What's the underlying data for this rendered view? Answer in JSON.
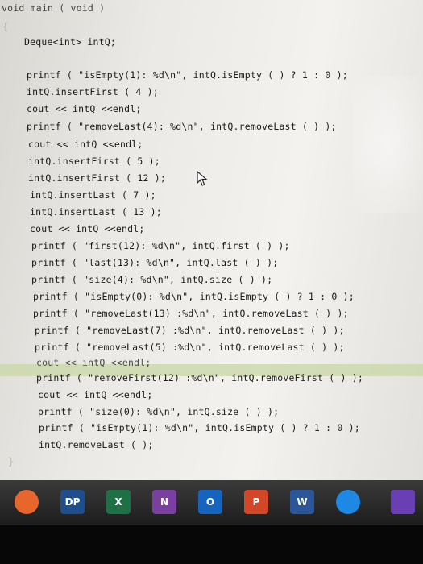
{
  "code": {
    "header": "void main ( void )",
    "open_brace": "{",
    "close_brace": "}",
    "declaration": "Deque<int> intQ;",
    "lines": [
      "printf ( \"isEmpty(1): %d\\n\", intQ.isEmpty ( ) ? 1 : 0 );",
      "intQ.insertFirst ( 4 );",
      "cout << intQ <<endl;",
      "printf ( \"removeLast(4): %d\\n\", intQ.removeLast ( ) );",
      "cout << intQ <<endl;",
      "intQ.insertFirst ( 5 );",
      "intQ.insertFirst ( 12 );",
      "intQ.insertLast ( 7 );",
      "intQ.insertLast ( 13 );",
      "cout << intQ <<endl;",
      "printf ( \"first(12): %d\\n\", intQ.first ( ) );",
      "printf ( \"last(13): %d\\n\", intQ.last ( ) );",
      "printf ( \"size(4): %d\\n\", intQ.size ( ) );",
      "printf ( \"isEmpty(0): %d\\n\", intQ.isEmpty ( ) ? 1 : 0 );",
      "printf ( \"removeLast(13) :%d\\n\", intQ.removeLast ( ) );",
      "printf ( \"removeLast(7) :%d\\n\", intQ.removeLast ( ) );",
      "printf ( \"removeLast(5) :%d\\n\", intQ.removeLast ( ) );",
      "cout << intQ <<endl;",
      "printf ( \"removeFirst(12) :%d\\n\", intQ.removeFirst ( ) );",
      "cout << intQ <<endl;",
      "printf ( \"size(0): %d\\n\", intQ.size ( ) );",
      "printf ( \"isEmpty(1): %d\\n\", intQ.isEmpty ( ) ? 1 : 0 );",
      "intQ.removeLast ( );"
    ],
    "highlighted_line_index": 17
  },
  "taskbar": {
    "items": [
      {
        "name": "firefox-icon",
        "label": "",
        "color": "#e8662b"
      },
      {
        "name": "photoshop-dp-icon",
        "label": "DP",
        "color": "#1f4e8c"
      },
      {
        "name": "excel-icon",
        "label": "X",
        "color": "#1e7145"
      },
      {
        "name": "onenote-icon",
        "label": "N",
        "color": "#7b3fa0"
      },
      {
        "name": "outlook-icon",
        "label": "O",
        "color": "#1565c0"
      },
      {
        "name": "powerpoint-icon",
        "label": "P",
        "color": "#d24726"
      },
      {
        "name": "word-icon",
        "label": "W",
        "color": "#2b579a"
      },
      {
        "name": "edge-icon",
        "label": "",
        "color": "#1e88e5"
      },
      {
        "name": "visual-studio-icon",
        "label": "",
        "color": "#6a3fb3"
      }
    ]
  }
}
